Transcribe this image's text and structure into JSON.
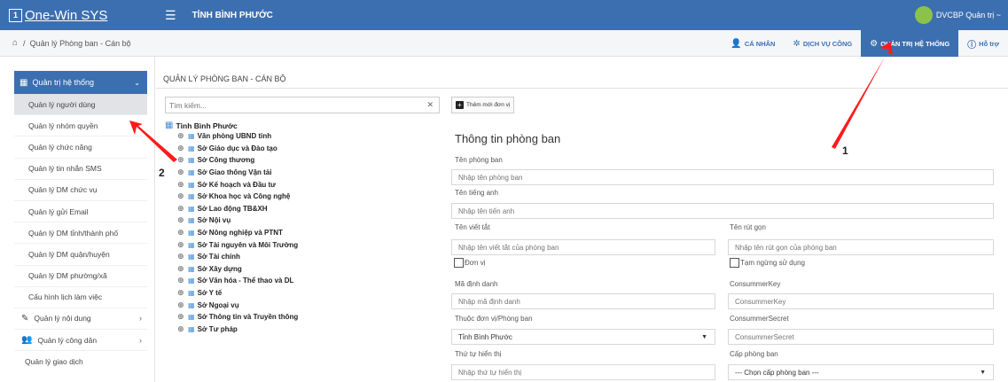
{
  "app": {
    "logo_letter": "1",
    "logo_text": "One-Win SYS",
    "province": "TỈNH BÌNH PHƯỚC",
    "user": "DVCBP Quản trị ~"
  },
  "breadcrumb": {
    "text": "Quản lý Phòng ban - Cán bộ"
  },
  "topnav": [
    {
      "label": "CÁ NHÂN",
      "icon": "user-icon"
    },
    {
      "label": "DỊCH VỤ CÔNG",
      "icon": "services-icon"
    },
    {
      "label": "QUẢN TRỊ HỆ THỐNG",
      "icon": "admin-icon",
      "active": true
    },
    {
      "label": "Hỗ trợ",
      "icon": "help-icon"
    }
  ],
  "sidebar": {
    "header": "Quản trị hệ thống",
    "items": [
      "Quản lý người dùng",
      "Quản lý nhóm quyền",
      "Quản lý chức năng",
      "Quản lý tin nhắn SMS",
      "Quản lý DM chức vụ",
      "Quản lý gửi Email",
      "Quản lý DM tỉnh/thành phố",
      "Quản lý DM quận/huyện",
      "Quản lý DM phường/xã",
      "Cấu hình lịch làm việc"
    ],
    "groups": [
      "Quản lý nội dung",
      "Quản lý công dân"
    ],
    "last": "Quản lý giao dịch"
  },
  "page": {
    "title": "QUẢN LÝ PHÒNG BAN - CÁN BỘ"
  },
  "tree": {
    "search_placeholder": "Tìm kiếm...",
    "root": "Tỉnh Bình Phước",
    "nodes": [
      "Văn phòng UBND tỉnh",
      "Sở Giáo dục và Đào tạo",
      "Sở Công thương",
      "Sở Giao thông Vận tải",
      "Sở Kế hoạch và Đầu tư",
      "Sở Khoa học và Công nghệ",
      "Sở Lao động TB&XH",
      "Sở Nội vụ",
      "Sở Nông nghiệp và PTNT",
      "Sở Tài nguyên và Môi Trường",
      "Sở Tài chính",
      "Sở Xây dựng",
      "Sở Văn hóa - Thể thao và DL",
      "Sở Y tế",
      "Sở Ngoại vụ",
      "Sở Thông tin và Truyền thông",
      "Sở Tư pháp"
    ]
  },
  "form": {
    "add_button": "Thêm mới đơn vị",
    "title": "Thông tin phòng ban",
    "ten_phong_ban": {
      "label": "Tên phòng ban",
      "placeholder": "Nhập tên phòng ban"
    },
    "ten_tieng_anh": {
      "label": "Tên tiếng anh",
      "placeholder": "Nhập tên tiến anh"
    },
    "ten_viet_tat": {
      "label": "Tên viết tắt",
      "placeholder": "Nhập tên viết tắt của phòng ban"
    },
    "ten_rut_gon": {
      "label": "Tên rút gọn",
      "placeholder": "Nhập tên rút gọn của phòng ban"
    },
    "don_vi": "Đơn vị",
    "tam_ngung": "Tạm ngừng sử dụng",
    "ma_dinh_danh": {
      "label": "Mã định danh",
      "placeholder": "Nhập mã định danh"
    },
    "consumer_key": {
      "label": "ConsummerKey",
      "placeholder": "ConsummerKey"
    },
    "thuoc_don_vi": {
      "label": "Thuộc đơn vị/Phòng ban",
      "value": "Tỉnh Bình Phước"
    },
    "consumer_secret": {
      "label": "ConsummerSecret",
      "placeholder": "ConsummerSecret"
    },
    "thu_tu": {
      "label": "Thứ tự hiển thị",
      "placeholder": "Nhập thứ tự hiển thị"
    },
    "cap_phong_ban": {
      "label": "Cấp phòng ban",
      "value": "--- Chọn cấp phòng ban ---"
    }
  },
  "annotations": {
    "one": "1",
    "two": "2",
    "arrow_color": "#ff1a1a"
  }
}
